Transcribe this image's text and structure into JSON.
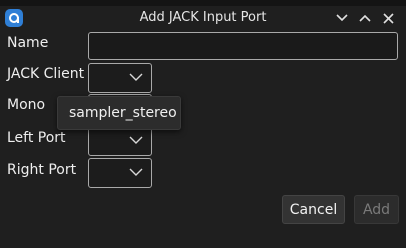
{
  "window": {
    "title": "Add JACK Input Port"
  },
  "form": {
    "name_label": "Name",
    "name_value": "",
    "jack_client_label": "JACK Client",
    "mono_label": "Mono",
    "left_port_label": "Left Port",
    "right_port_label": "Right Port"
  },
  "popup": {
    "items": [
      "sampler_stereo"
    ]
  },
  "buttons": {
    "cancel": "Cancel",
    "add": "Add"
  },
  "colors": {
    "app_icon": "#2f7fd6",
    "background": "#1f1f1f",
    "border": "#a9a9a9",
    "disabled_text": "#7a7a7a"
  },
  "icons": {
    "app": "app-logo-icon",
    "minimize": "chevron-down-icon",
    "maximize": "chevron-up-icon",
    "close": "close-icon",
    "combo": "chevron-down-icon"
  }
}
